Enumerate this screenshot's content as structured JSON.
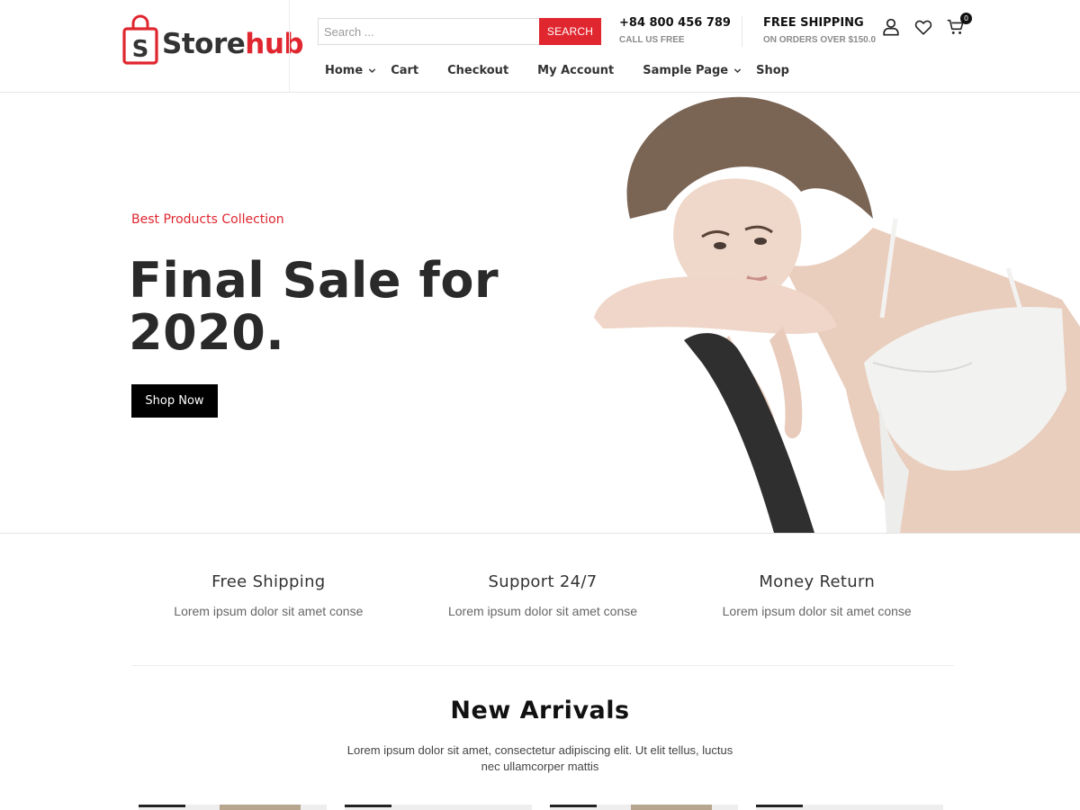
{
  "header": {
    "logo": {
      "part1": "Store",
      "part2": "hub",
      "bag_letter": "S"
    },
    "search": {
      "placeholder": "Search ...",
      "button_label": "SEARCH"
    },
    "contact": {
      "phone": "+84 800 456 789",
      "caption": "CALL US FREE"
    },
    "shipping": {
      "title": "FREE SHIPPING",
      "caption": "ON ORDERS OVER $150.0"
    },
    "icons": [
      "user-icon",
      "heart-icon",
      "cart-icon"
    ],
    "cart_count": "0"
  },
  "nav": {
    "items": [
      {
        "label": "Home",
        "has_dropdown": true
      },
      {
        "label": "Cart",
        "has_dropdown": false
      },
      {
        "label": "Checkout",
        "has_dropdown": false
      },
      {
        "label": "My Account",
        "has_dropdown": false
      },
      {
        "label": "Sample Page",
        "has_dropdown": true
      },
      {
        "label": "Shop",
        "has_dropdown": false
      }
    ]
  },
  "hero": {
    "kicker": "Best Products Collection",
    "title": "Final Sale for 2020.",
    "button_label": "Shop Now"
  },
  "features": [
    {
      "title": "Free Shipping",
      "text": "Lorem ipsum dolor sit amet conse"
    },
    {
      "title": "Support 24/7",
      "text": "Lorem ipsum dolor sit amet conse"
    },
    {
      "title": "Money Return",
      "text": "Lorem ipsum dolor sit amet conse"
    }
  ],
  "arrivals": {
    "title": "New Arrivals",
    "text": "Lorem ipsum dolor sit amet, consectetur adipiscing elit. Ut elit tellus, luctus nec ullamcorper mattis"
  },
  "colors": {
    "accent": "#e0262f",
    "dark": "#111111",
    "text": "#333333",
    "muted": "#8a8a8a"
  }
}
